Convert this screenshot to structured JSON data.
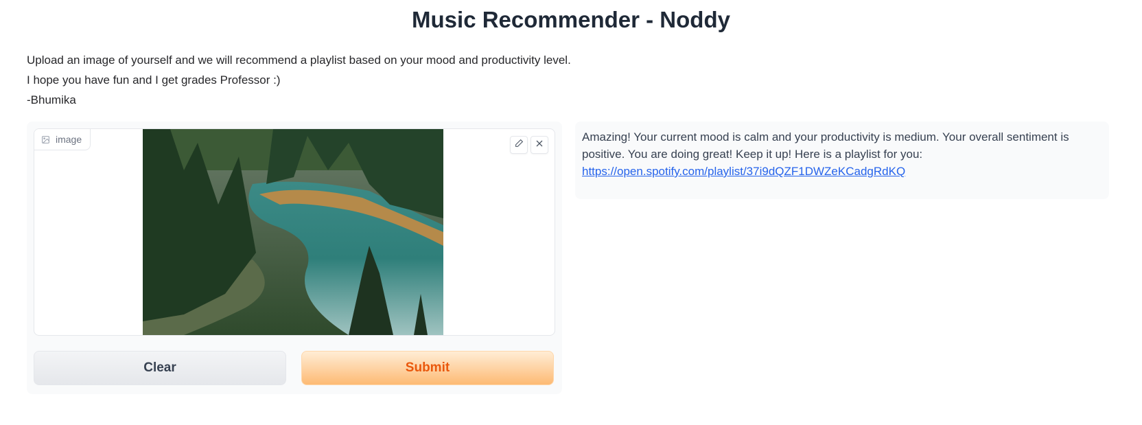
{
  "header": {
    "title": "Music Recommender - Noddy"
  },
  "description": {
    "lines": [
      "Upload an image of yourself and we will recommend a playlist based on your mood and productivity level.",
      "I hope you have fun and I get grades Professor :)",
      "-Bhumika"
    ]
  },
  "input": {
    "label": "image",
    "label_icon": "image-icon",
    "edit_icon": "pencil-icon",
    "clear_icon": "close-icon"
  },
  "buttons": {
    "clear": "Clear",
    "submit": "Submit"
  },
  "output": {
    "text": "Amazing! Your current mood is calm and your productivity is medium. Your overall sentiment is positive. You are doing great! Keep it up! Here is a playlist for you:",
    "link": "https://open.spotify.com/playlist/37i9dQZF1DWZeKCadgRdKQ"
  },
  "colors": {
    "submit_text": "#ea580c",
    "submit_bg": "#fdba74",
    "link": "#2563eb"
  }
}
